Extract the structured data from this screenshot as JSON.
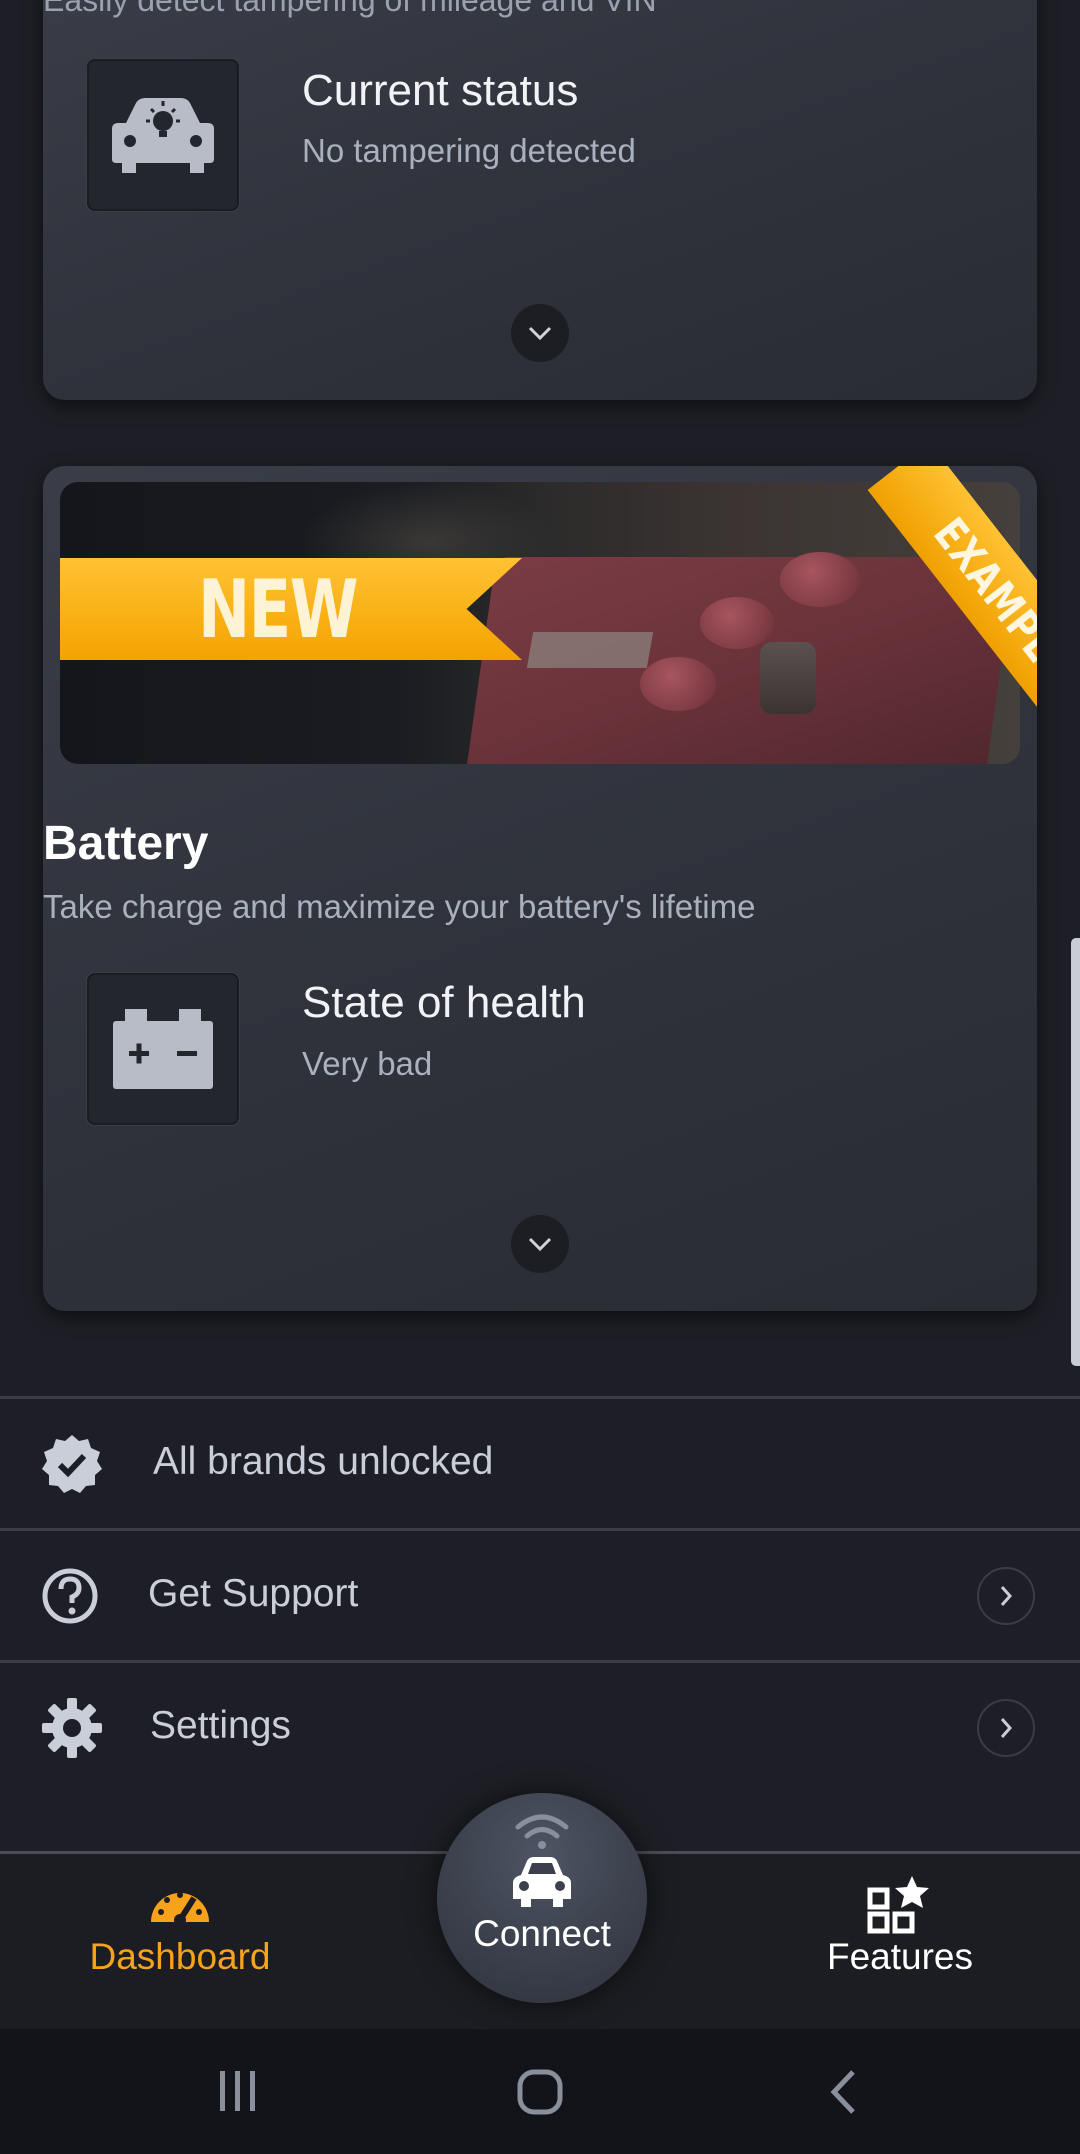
{
  "tampering_card": {
    "subtitle_cut": "Easily detect tampering of mileage and VIN",
    "item_title": "Current status",
    "item_value": "No tampering detected"
  },
  "battery_card": {
    "banner_badge": "NEW",
    "banner_ribbon": "EXAMPLE",
    "title": "Battery",
    "subtitle": "Take charge and maximize your battery's lifetime",
    "item_title": "State of health",
    "item_value": "Very bad"
  },
  "menu": {
    "brands": "All brands unlocked",
    "support": "Get Support",
    "settings": "Settings"
  },
  "bottom_nav": {
    "dashboard": "Dashboard",
    "connect": "Connect",
    "features": "Features",
    "active": "dashboard",
    "active_color": "#f7a21b"
  },
  "icons": {
    "status": "car-bulb-icon",
    "battery": "battery-icon",
    "brands": "verified-badge-icon",
    "support": "help-circle-icon",
    "settings": "gear-icon",
    "dashboard": "speedometer-icon",
    "connect": "car-wifi-icon",
    "features": "grid-star-icon"
  }
}
